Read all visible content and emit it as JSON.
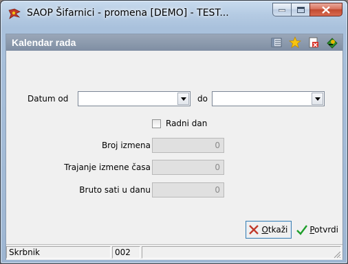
{
  "window": {
    "title": "SAOP  Šifarnici - promena [DEMO] - TEST...",
    "controls": [
      "minimize-icon",
      "maximize-icon",
      "close-icon"
    ]
  },
  "form": {
    "title": "Kalendar rada",
    "header_icons": [
      "list-icon",
      "star-icon",
      "delete-document-icon",
      "exit-icon"
    ]
  },
  "fields": {
    "datum_od_label": "Datum od",
    "datum_od_value": "",
    "do_label": "do",
    "do_value": "",
    "radni_dan_label": "Radni dan",
    "radni_dan_checked": false,
    "broj_izmena_label": "Broj izmena",
    "broj_izmena_value": "0",
    "trajanje_label": "Trajanje izmene časa",
    "trajanje_value": "0",
    "bruto_label": "Bruto sati u danu",
    "bruto_value": "0"
  },
  "buttons": {
    "cancel_underlined": "O",
    "cancel_rest": "tkaži",
    "confirm_underlined": "P",
    "confirm_rest": "otvrdi"
  },
  "status": {
    "user": "Skrbnik",
    "code": "002",
    "extra": ""
  },
  "colors": {
    "header_bg": "#7f8ea3",
    "client_bg": "#f0f0f0",
    "close_btn": "#c14a30"
  }
}
